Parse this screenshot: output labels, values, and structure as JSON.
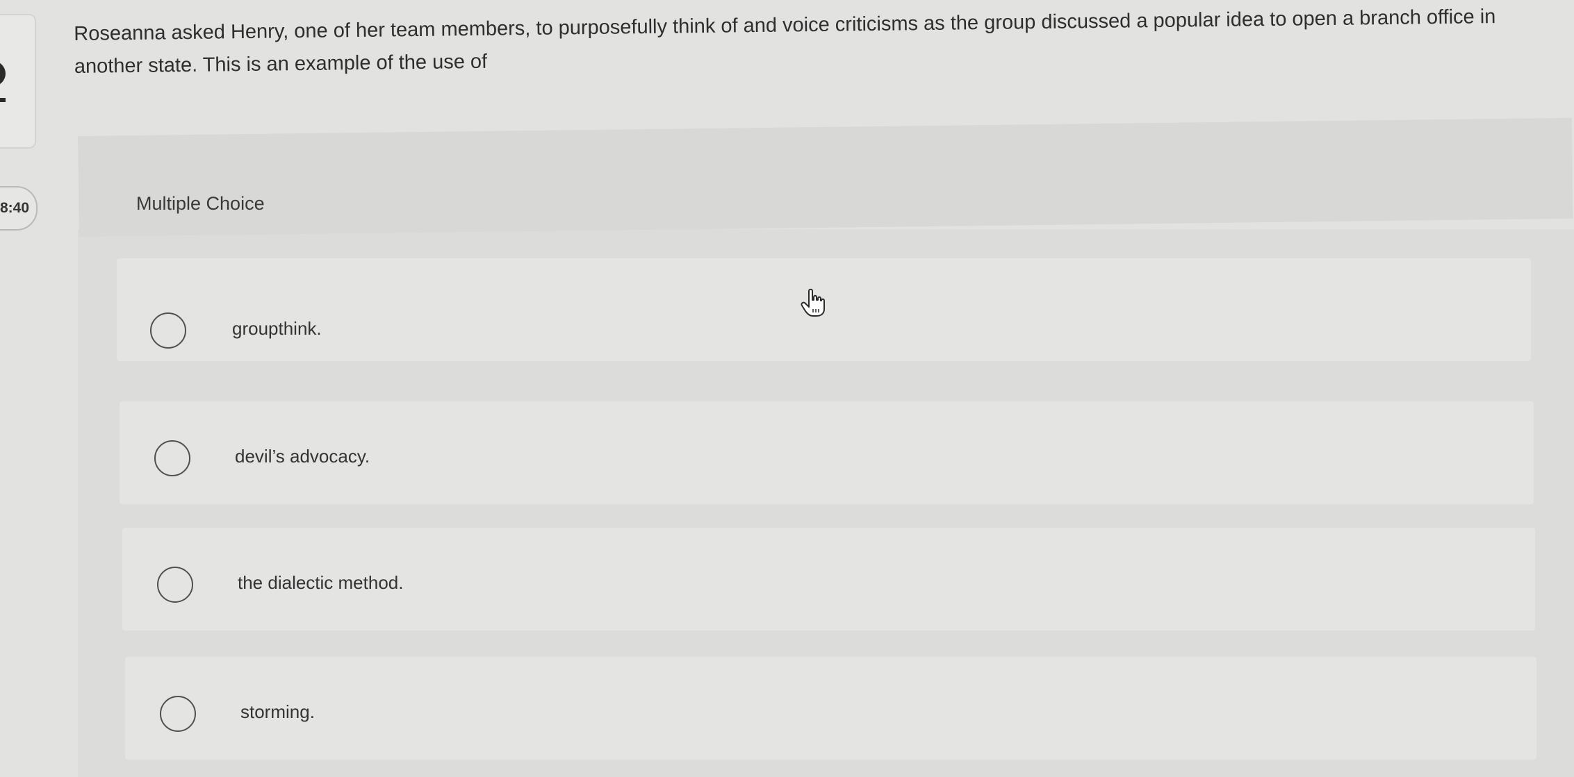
{
  "sidebar": {
    "timer": "8:40"
  },
  "question": {
    "text": "Roseanna asked Henry, one of her team members, to purposefully think of and voice criticisms as the group discussed a popular idea to open a branch office in another state. This is an example of the use of"
  },
  "multiple_choice": {
    "label": "Multiple Choice",
    "options": [
      {
        "label": "groupthink."
      },
      {
        "label": "devil’s advocacy."
      },
      {
        "label": "the dialectic method."
      },
      {
        "label": "storming."
      }
    ]
  },
  "cursor": {
    "icon": "hand-pointer-icon"
  }
}
